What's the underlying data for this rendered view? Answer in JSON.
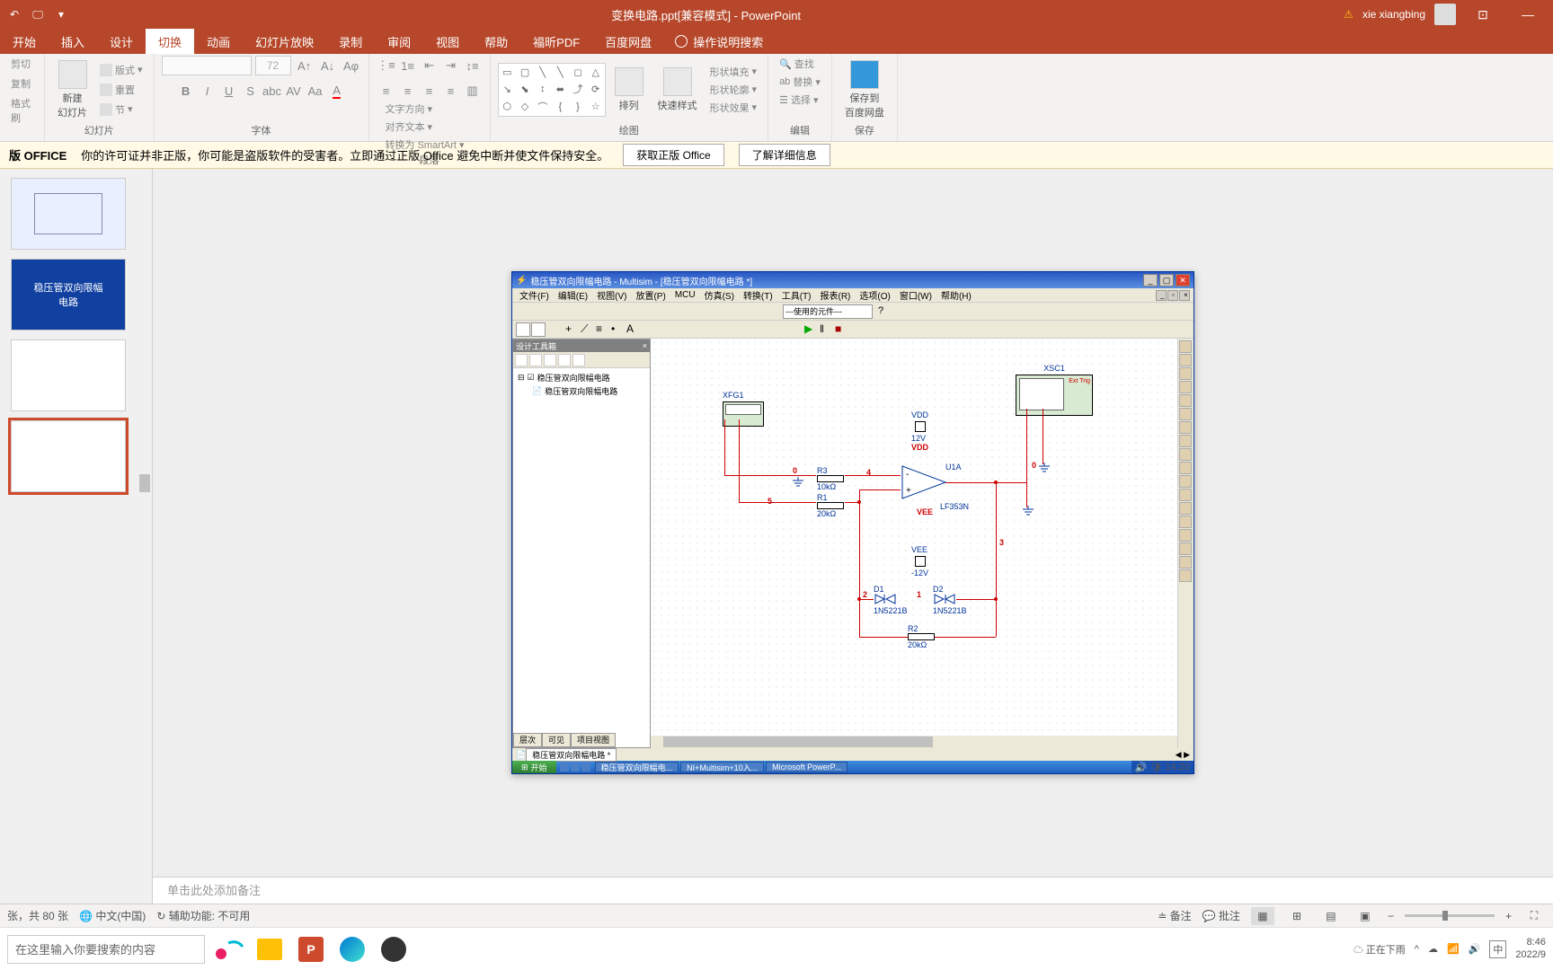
{
  "titlebar": {
    "doc_title": "变换电路.ppt[兼容模式] - PowerPoint",
    "username": "xie xiangbing"
  },
  "tabs": {
    "start": "开始",
    "items": [
      "插入",
      "设计",
      "切换",
      "动画",
      "幻灯片放映",
      "录制",
      "审阅",
      "视图",
      "帮助",
      "福昕PDF",
      "百度网盘"
    ],
    "tell_me": "操作说明搜索"
  },
  "ribbon": {
    "clipboard": {
      "cut": "剪切",
      "copy": "复制",
      "painter": "格式刷"
    },
    "slides": {
      "new_slide": "新建\n幻灯片",
      "layout": "版式",
      "reset": "重置",
      "section": "节",
      "label": "幻灯片"
    },
    "font": {
      "size": "72",
      "label": "字体"
    },
    "paragraph": {
      "dir": "文字方向",
      "align": "对齐文本",
      "smart": "转换为 SmartArt",
      "label": "段落"
    },
    "drawing": {
      "arrange": "排列",
      "quick": "快速样式",
      "fill": "形状填充",
      "outline": "形状轮廓",
      "effects": "形状效果",
      "label": "绘图"
    },
    "editing": {
      "find": "查找",
      "replace": "替换",
      "select": "选择",
      "label": "编辑"
    },
    "save": {
      "btn": "保存到\n百度网盘",
      "label": "保存"
    }
  },
  "warning": {
    "title": "版 OFFICE",
    "msg": "你的许可证并非正版，你可能是盗版软件的受害者。立即通过正版 Office 避免中断并使文件保持安全。",
    "btn1": "获取正版 Office",
    "btn2": "了解详细信息"
  },
  "thumbs": {
    "blue_title": "稳压管双向限幅\n电路"
  },
  "multisim": {
    "title": "稳压管双向限幅电路 - Multisim - [稳压管双向限幅电路 *]",
    "menus": [
      "文件(F)",
      "编辑(E)",
      "视图(V)",
      "放置(P)",
      "MCU",
      "仿真(S)",
      "转换(T)",
      "工具(T)",
      "报表(R)",
      "选项(O)",
      "窗口(W)",
      "帮助(H)"
    ],
    "combo": "---使用的元件---",
    "tree": {
      "title": "设计工具箱",
      "root": "稳压管双向限幅电路",
      "child": "稳压管双向限幅电路",
      "tabs": [
        "层次",
        "可见",
        "项目视图"
      ]
    },
    "doc_tab": "稳压管双向限幅电路 *",
    "circuit": {
      "xfg1": "XFG1",
      "xsc1": "XSC1",
      "ext_trig": "Ext Trig",
      "r1": "R1",
      "r1_val": "20kΩ",
      "r2": "R2",
      "r2_val": "20kΩ",
      "r3": "R3",
      "r3_val": "10kΩ",
      "d1": "D1",
      "d1_val": "1N5221B",
      "d2": "D2",
      "d2_val": "1N5221B",
      "u1a": "U1A",
      "opamp": "LF353N",
      "vdd": "VDD",
      "vdd_v": "12V",
      "vdd_lbl": "VDD",
      "vee": "VEE",
      "vee_v": "-12V",
      "vee_lbl": "VEE",
      "nets": {
        "n0": "0",
        "n1": "1",
        "n2": "2",
        "n3": "3",
        "n4": "4",
        "n5": "5",
        "n0b": "0"
      }
    },
    "taskbar": {
      "start": "开始",
      "tasks": [
        "稳压管双向限幅电...",
        "NI+Multisim+10入...",
        "Microsoft PowerP..."
      ],
      "time": "14:20"
    }
  },
  "notes": "单击此处添加备注",
  "status": {
    "slide": "张，共 80 张",
    "lang": "中文(中国)",
    "access": "辅助功能: 不可用",
    "notes_btn": "备注",
    "comments": "批注"
  },
  "wintask": {
    "search": "在这里输入你要搜索的内容",
    "weather": "正在下雨",
    "ime": "中",
    "time": "8:46",
    "date": "2022/9"
  }
}
